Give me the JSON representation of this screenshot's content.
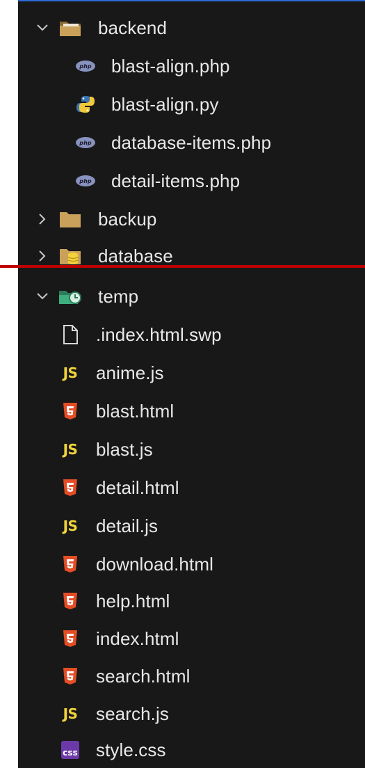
{
  "tree": {
    "backend": {
      "label": "backend",
      "files": [
        {
          "label": "blast-align.php",
          "icon": "php-icon"
        },
        {
          "label": "blast-align.py",
          "icon": "python-icon"
        },
        {
          "label": "database-items.php",
          "icon": "php-icon"
        },
        {
          "label": "detail-items.php",
          "icon": "php-icon"
        }
      ]
    },
    "backup": {
      "label": "backup"
    },
    "database": {
      "label": "database"
    },
    "temp": {
      "label": "temp",
      "files": [
        {
          "label": ".index.html.swp",
          "icon": "file-icon"
        },
        {
          "label": "anime.js",
          "icon": "js-icon"
        },
        {
          "label": "blast.html",
          "icon": "html-icon"
        },
        {
          "label": "blast.js",
          "icon": "js-icon"
        },
        {
          "label": "detail.html",
          "icon": "html-icon"
        },
        {
          "label": "detail.js",
          "icon": "js-icon"
        },
        {
          "label": "download.html",
          "icon": "html-icon"
        },
        {
          "label": "help.html",
          "icon": "html-icon"
        },
        {
          "label": "index.html",
          "icon": "html-icon"
        },
        {
          "label": "search.html",
          "icon": "html-icon"
        },
        {
          "label": "search.js",
          "icon": "js-icon"
        },
        {
          "label": "style.css",
          "icon": "css-icon"
        }
      ]
    }
  },
  "badges": {
    "js": "JS",
    "css": "css"
  },
  "colors": {
    "background": "#181818",
    "text": "#e8e8e8",
    "folder": "#c9a15b",
    "html": "#e44d26",
    "js": "#f1d43b",
    "css": "#6c3aa8",
    "php": "#8892bf",
    "highlight_line": "#c00000",
    "top_border": "#2f6bd8"
  }
}
